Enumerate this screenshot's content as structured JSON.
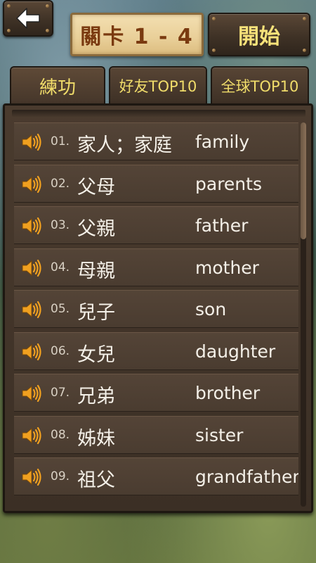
{
  "header": {
    "back_icon": "left-arrow-icon",
    "level_label": "關卡 1 - 4",
    "start_label": "開始"
  },
  "tabs": [
    {
      "label": "練功",
      "active": true
    },
    {
      "label": "好友TOP10",
      "active": false
    },
    {
      "label": "全球TOP10",
      "active": false
    }
  ],
  "words": [
    {
      "num": "01.",
      "zh": "家人；家庭",
      "en": "family"
    },
    {
      "num": "02.",
      "zh": "父母",
      "en": "parents"
    },
    {
      "num": "03.",
      "zh": "父親",
      "en": "father"
    },
    {
      "num": "04.",
      "zh": "母親",
      "en": "mother"
    },
    {
      "num": "05.",
      "zh": "兒子",
      "en": "son"
    },
    {
      "num": "06.",
      "zh": "女兒",
      "en": "daughter"
    },
    {
      "num": "07.",
      "zh": "兄弟",
      "en": "brother"
    },
    {
      "num": "08.",
      "zh": "姊妹",
      "en": "sister"
    },
    {
      "num": "09.",
      "zh": "祖父",
      "en": "grandfather"
    }
  ],
  "colors": {
    "accent_yellow": "#f0dc6a",
    "level_text": "#7a3a10",
    "speaker_orange": "#f0a020"
  }
}
